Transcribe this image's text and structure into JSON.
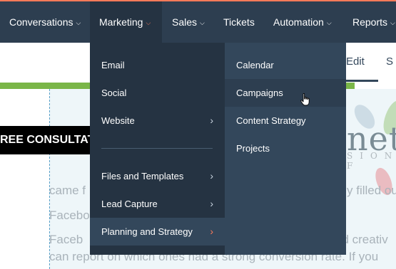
{
  "nav": {
    "items": [
      {
        "label": "Conversations",
        "chevron": "⌵"
      },
      {
        "label": "Marketing",
        "chevron": "⌵"
      },
      {
        "label": "Sales",
        "chevron": "⌵"
      },
      {
        "label": "Tickets",
        "chevron": ""
      },
      {
        "label": "Automation",
        "chevron": "⌵"
      },
      {
        "label": "Reports",
        "chevron": "⌵"
      }
    ],
    "active": "Marketing",
    "accent_color": "#ff7a59"
  },
  "menu": {
    "primary": [
      {
        "label": "Email",
        "has_submenu": false
      },
      {
        "label": "Social",
        "has_submenu": false
      },
      {
        "label": "Website",
        "has_submenu": true
      },
      {
        "label": "Files and Templates",
        "has_submenu": true
      },
      {
        "label": "Lead Capture",
        "has_submenu": true
      },
      {
        "label": "Planning and Strategy",
        "has_submenu": true
      }
    ],
    "selected": "Planning and Strategy",
    "submenu": [
      {
        "label": "Calendar"
      },
      {
        "label": "Campaigns"
      },
      {
        "label": "Content Strategy"
      },
      {
        "label": "Projects"
      }
    ],
    "hovered": "Campaigns",
    "arrow_glyph": "›"
  },
  "background": {
    "tabs": {
      "edit": "Edit",
      "next": "S"
    },
    "cta_text": "REE CONSULTAT",
    "logo_text": "neti",
    "logo_subtext": "SION  F",
    "text_lines": {
      "l1": "came f",
      "r1": "y filled ou",
      "l2": "Facebo",
      "l3": "Faceb",
      "r3": "ad creativ",
      "l4": "can report on which ones had a strong conversion rate. If you",
      "r4": ""
    }
  }
}
